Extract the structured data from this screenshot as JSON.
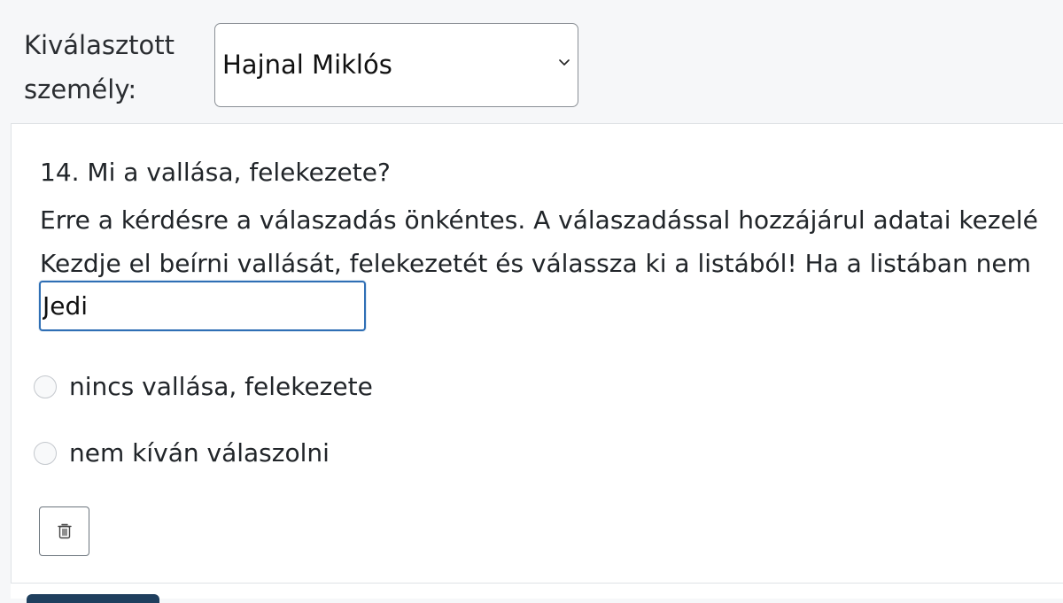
{
  "header": {
    "person_label": "Kiválasztott személy:",
    "selected_person": "Hajnal Miklós"
  },
  "question": {
    "title": "14. Mi a vallása, felekezete?",
    "help_lines": [
      "Erre a kérdésre a válaszadás önkéntes. A válaszadással hozzájárul adatai kezelé",
      "Kezdje el beírni vallását, felekezetét és válassza ki a listából! Ha a listában nem"
    ],
    "answer_value": "Jedi",
    "options": [
      {
        "label": "nincs vallása, felekezete",
        "selected": false
      },
      {
        "label": "nem kíván válaszolni",
        "selected": false
      }
    ]
  },
  "icons": {
    "select_arrow": "chevron-down-icon",
    "delete": "trash-icon"
  },
  "colors": {
    "focus_border": "#2f6fb5",
    "footer_button": "#1f3f5e"
  }
}
